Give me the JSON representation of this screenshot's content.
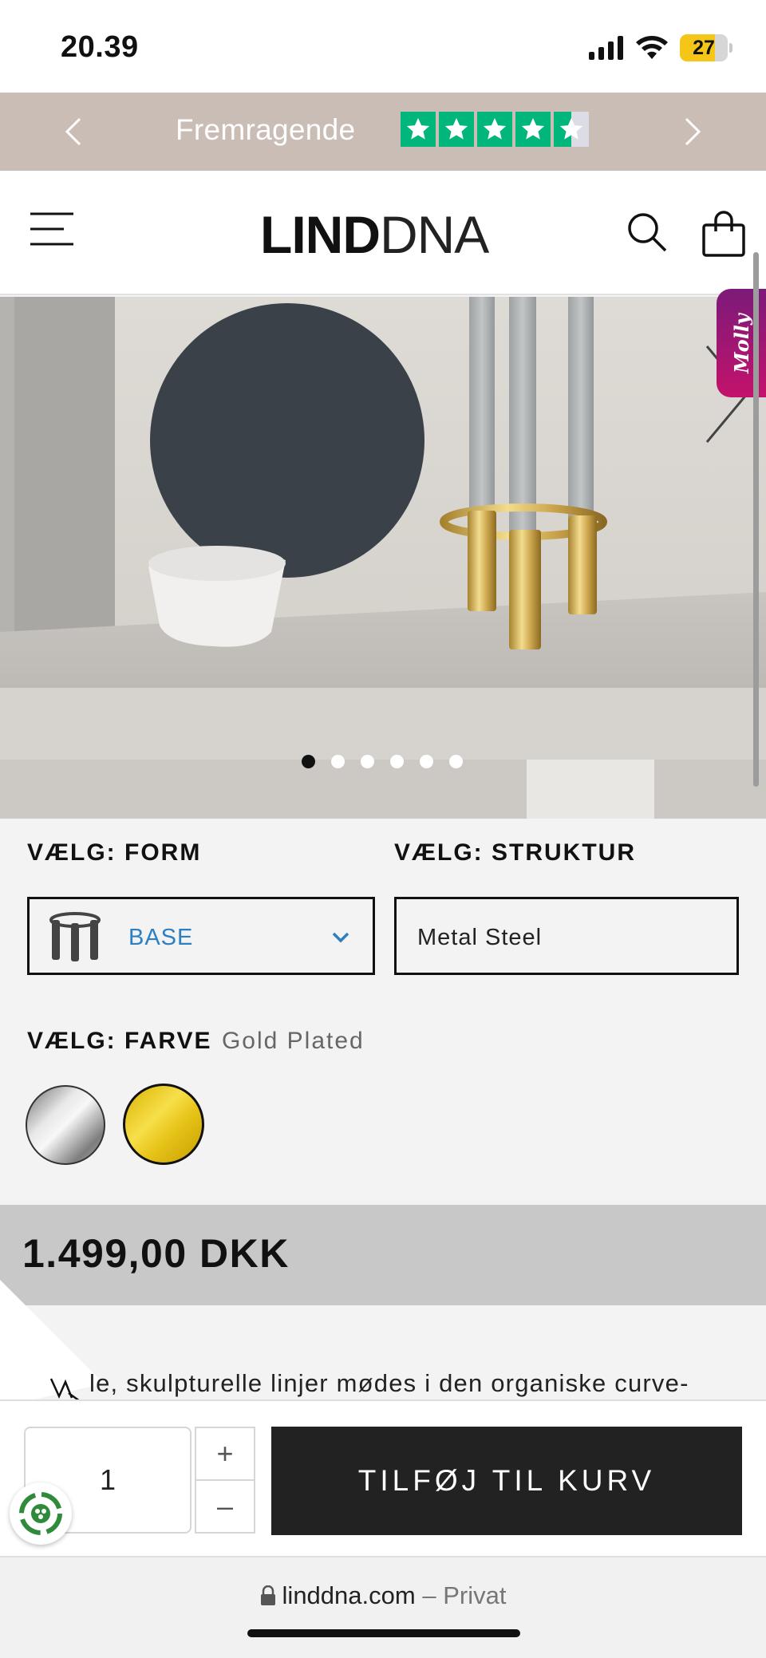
{
  "status_bar": {
    "time": "20.39",
    "battery": "27",
    "icons": [
      "cellular-signal-icon",
      "wifi-icon",
      "battery-icon"
    ]
  },
  "trust_bar": {
    "rating_label": "Fremragende",
    "stars": 4.5,
    "star_color": "#00b67a",
    "icons": [
      "chevron-left-icon",
      "chevron-right-icon"
    ]
  },
  "header": {
    "logo_bold": "LIND",
    "logo_light": "DNA",
    "icons": [
      "hamburger-menu-icon",
      "search-icon",
      "shopping-bag-icon"
    ]
  },
  "hero": {
    "slide_count": 6,
    "active_slide": 1,
    "side_tab_label": "Molly",
    "icons": [
      "chevron-right-icon"
    ]
  },
  "options": {
    "form": {
      "label": "VÆLG: FORM",
      "selected": "BASE"
    },
    "structure": {
      "label": "VÆLG: STRUKTUR",
      "selected": "Metal Steel"
    },
    "color": {
      "label": "VÆLG: FARVE",
      "selected": "Gold Plated",
      "swatches": [
        "silver",
        "gold"
      ]
    }
  },
  "price": "1.499,00 DKK",
  "description": "le, skulpturelle linjer mødes i den organiske curve-",
  "cart": {
    "quantity": "1",
    "plus": "+",
    "minus": "–",
    "add_label": "TILFØJ TIL KURV"
  },
  "browser": {
    "domain": "linddna.com",
    "separator": "–",
    "mode": "Privat"
  },
  "colors": {
    "accent_blue": "#2d7fc1",
    "trust_bar_bg": "#c9bdb6",
    "button_bg": "#222222",
    "price_bar_bg": "#c8c8c8"
  }
}
